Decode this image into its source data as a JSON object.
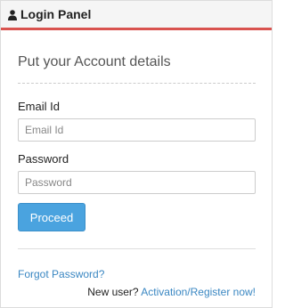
{
  "panel": {
    "title": "Login Panel",
    "icon": "user-icon",
    "accent_color": "#d9534f"
  },
  "form": {
    "subtitle": "Put your Account details",
    "email": {
      "label": "Email Id",
      "placeholder": "Email Id",
      "value": ""
    },
    "password": {
      "label": "Password",
      "placeholder": "Password",
      "value": ""
    },
    "submit_label": "Proceed",
    "button_color": "#4aa3df"
  },
  "links": {
    "forgot_password": "Forgot Password?",
    "new_user_prefix": "New user?",
    "register": "Activation/Register now!",
    "link_color": "#3a87c2"
  }
}
